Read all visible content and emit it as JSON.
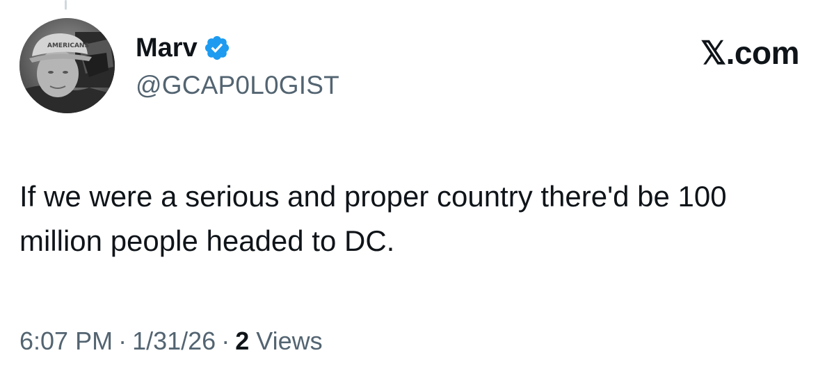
{
  "author": {
    "display_name": "Marv",
    "handle": "@GCAP0L0GIST",
    "verified": true,
    "avatar_icon": "profile-photo-avatar",
    "badge_icon": "verified-badge-icon"
  },
  "brand": {
    "label": "𝕏.com"
  },
  "tweet": {
    "text": "If we were a serious and proper country there'd be 100 million people headed to DC."
  },
  "meta": {
    "time": "6:07 PM",
    "separator": "·",
    "date": "1/31/26",
    "views_count": "2",
    "views_label": "Views"
  },
  "colors": {
    "text_primary": "#0f1419",
    "text_secondary": "#536471",
    "verified_blue": "#1d9bf0",
    "background": "#ffffff"
  }
}
